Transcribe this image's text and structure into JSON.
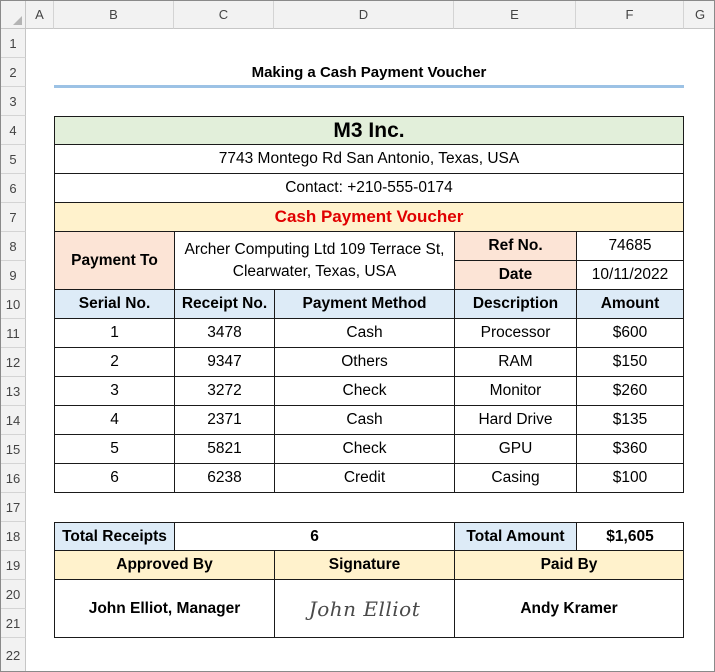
{
  "columns": [
    "A",
    "B",
    "C",
    "D",
    "E",
    "F",
    "G"
  ],
  "rows": [
    "1",
    "2",
    "3",
    "4",
    "5",
    "6",
    "7",
    "8",
    "9",
    "10",
    "11",
    "12",
    "13",
    "14",
    "15",
    "16",
    "17",
    "18",
    "19",
    "20",
    "21",
    "22"
  ],
  "sheet_title": "Making a Cash Payment Voucher",
  "company": {
    "name": "M3 Inc.",
    "address": "7743 Montego Rd San Antonio, Texas, USA",
    "contact": "Contact: +210-555-0174"
  },
  "voucher_title": "Cash Payment Voucher",
  "payment_to": {
    "label": "Payment To",
    "value": "Archer Computing Ltd 109 Terrace St, Clearwater, Texas, USA"
  },
  "ref": {
    "label": "Ref No.",
    "value": "74685"
  },
  "date": {
    "label": "Date",
    "value": "10/11/2022"
  },
  "table": {
    "headers": [
      "Serial No.",
      "Receipt No.",
      "Payment Method",
      "Description",
      "Amount"
    ],
    "rows": [
      [
        "1",
        "3478",
        "Cash",
        "Processor",
        "$600"
      ],
      [
        "2",
        "9347",
        "Others",
        "RAM",
        "$150"
      ],
      [
        "3",
        "3272",
        "Check",
        "Monitor",
        "$260"
      ],
      [
        "4",
        "2371",
        "Cash",
        "Hard Drive",
        "$135"
      ],
      [
        "5",
        "5821",
        "Check",
        "GPU",
        "$360"
      ],
      [
        "6",
        "6238",
        "Credit",
        "Casing",
        "$100"
      ]
    ]
  },
  "totals": {
    "receipts_label": "Total Receipts",
    "receipts_value": "6",
    "amount_label": "Total Amount",
    "amount_value": "$1,605"
  },
  "approval": {
    "approved_by_label": "Approved By",
    "signature_label": "Signature",
    "paid_by_label": "Paid By",
    "approved_by": "John Elliot, Manager",
    "signature": "John Elliot",
    "paid_by": "Andy Kramer"
  },
  "colors": {
    "company_band": "#e2efda",
    "voucher_band": "#fff2cc",
    "label_peach": "#fce4d6",
    "header_blue": "#ddebf7",
    "voucher_text": "#e00000",
    "title_underline": "#9cc2e5"
  }
}
